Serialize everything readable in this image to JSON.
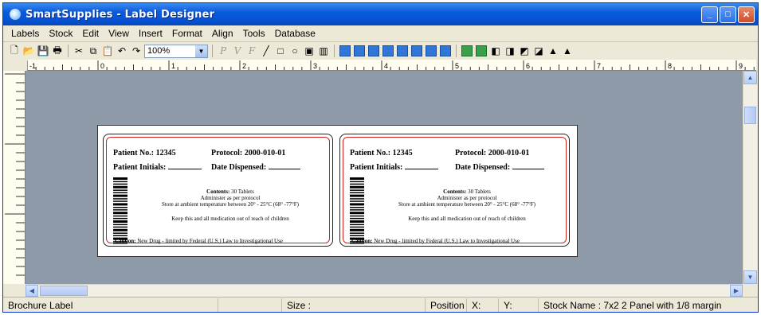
{
  "window": {
    "title": "SmartSupplies - Label Designer"
  },
  "menu": [
    "Labels",
    "Stock",
    "Edit",
    "View",
    "Insert",
    "Format",
    "Align",
    "Tools",
    "Database"
  ],
  "toolbar": {
    "zoom_value": "100%"
  },
  "ruler": {
    "marks": [
      "-1",
      "0",
      "1",
      "2",
      "3",
      "4",
      "5",
      "6",
      "7",
      "8",
      "9"
    ]
  },
  "labels": [
    {
      "patient_no_label": "Patient No.: 12345",
      "protocol_label": "Protocol: 2000-010-01",
      "initials_label": "Patient Initials:",
      "date_dispensed_label": "Date Dispensed:",
      "contents_title": "Contents:",
      "contents_value": "30 Tablets",
      "administer": "Administer as per protocol",
      "store": "Store at ambient temperature between 20° - 25°C (68° -77°F)",
      "keep": "Keep this and all medication out of reach of children",
      "caution_title": "Caution:",
      "caution_text": "New Drug - limited by Federal (U.S.) Law to Investigational Use"
    },
    {
      "patient_no_label": "Patient No.: 12345",
      "protocol_label": "Protocol: 2000-010-01",
      "initials_label": "Patient Initials:",
      "date_dispensed_label": "Date Dispensed:",
      "contents_title": "Contents:",
      "contents_value": "30 Tablets",
      "administer": "Administer as per protocol",
      "store": "Store at ambient temperature between 20° - 25°C (68° -77°F)",
      "keep": "Keep this and all medication out of reach of children",
      "caution_title": "Caution:",
      "caution_text": "New Drug - limited by Federal (U.S.) Law to Investigational Use"
    }
  ],
  "status": {
    "label_name": "Brochure Label",
    "size": "Size :",
    "position": "Position",
    "x": "X:",
    "y": "Y:",
    "stock_name": "Stock Name : 7x2 2 Panel with 1/8 margin"
  }
}
